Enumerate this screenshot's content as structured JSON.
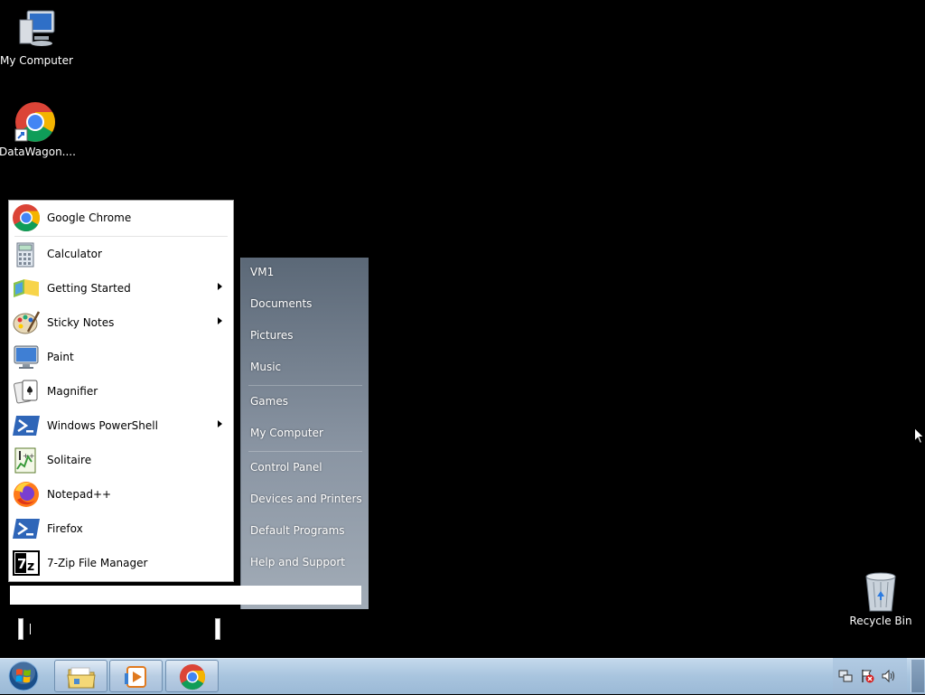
{
  "desktop": {
    "icons": [
      {
        "label": "My Computer",
        "icon": "computer-icon"
      },
      {
        "label": "DataWagon....",
        "icon": "chrome-shortcut-icon"
      },
      {
        "label": "Recycle Bin",
        "icon": "recycle-bin-icon"
      }
    ]
  },
  "start_menu": {
    "pinned": [
      {
        "label": "Google Chrome",
        "icon": "chrome-icon",
        "submenu": false
      }
    ],
    "programs": [
      {
        "label": "Calculator",
        "icon": "calculator-icon",
        "submenu": false
      },
      {
        "label": "Getting Started",
        "icon": "getting-started-icon",
        "submenu": true
      },
      {
        "label": "Sticky Notes",
        "icon": "paint-palette-icon",
        "submenu": true
      },
      {
        "label": "Paint",
        "icon": "monitor-icon",
        "submenu": false
      },
      {
        "label": "Magnifier",
        "icon": "solitaire-cards-icon",
        "submenu": false
      },
      {
        "label": "Windows PowerShell",
        "icon": "powershell-icon",
        "submenu": true
      },
      {
        "label": "Solitaire",
        "icon": "notepad-plus-icon",
        "submenu": false
      },
      {
        "label": "Notepad++",
        "icon": "firefox-icon",
        "submenu": false
      },
      {
        "label": "Firefox",
        "icon": "powershell-icon",
        "submenu": false
      },
      {
        "label": "7-Zip File Manager",
        "icon": "7zip-icon",
        "submenu": false
      }
    ],
    "right_links": [
      {
        "label": "VM1"
      },
      {
        "label": "Documents"
      },
      {
        "label": "Pictures"
      },
      {
        "label": "Music"
      },
      {
        "label": "Games"
      },
      {
        "label": "My Computer"
      },
      {
        "label": "Control Panel"
      },
      {
        "label": "Devices and Printers"
      },
      {
        "label": "Default Programs"
      },
      {
        "label": "Help and Support"
      }
    ],
    "search": {
      "placeholder": "",
      "value": ""
    }
  },
  "taskbar": {
    "start_button": "windows-orb-icon",
    "buttons": [
      {
        "name": "explorer",
        "icon": "folder-icon"
      },
      {
        "name": "media-player",
        "icon": "media-player-icon"
      },
      {
        "name": "chrome",
        "icon": "chrome-icon"
      }
    ],
    "tray_icons": [
      "network-icon",
      "action-center-flag-icon",
      "volume-icon"
    ]
  }
}
